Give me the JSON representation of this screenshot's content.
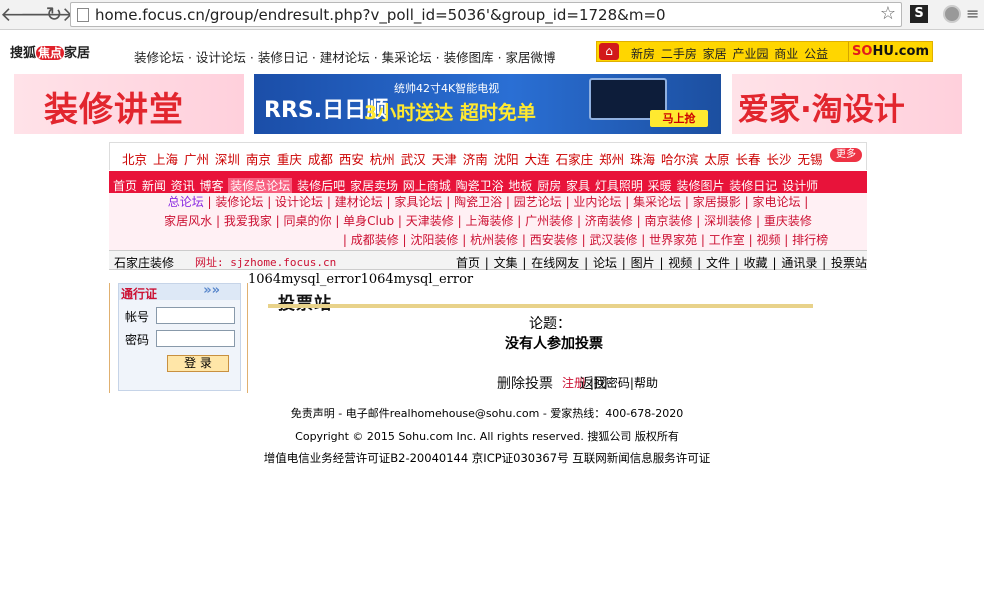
{
  "browser": {
    "url": "home.focus.cn/group/endresult.php?v_poll_id=5036'&group_id=1728&m=0",
    "ext_label": "S"
  },
  "header": {
    "logo_sohu": "搜狐",
    "logo_mid": "焦点",
    "logo_home": "家居",
    "topnav": "装修论坛 · 设计论坛 · 装修日记 · 建材论坛 · 集采论坛 · 装修图库 · 家居微博",
    "sohu_links": "新房 二手房 家居 产业园 商业 公益",
    "sohu_brand_pre": "S",
    "sohu_brand_o": "O",
    "sohu_brand_post": "HU.com"
  },
  "banners": {
    "left": "装修讲堂",
    "mid_rrs": "RRS.日日顺",
    "mid_line1": "统帅42寸4K智能电视",
    "mid_line2": "3小时送达 超时免单",
    "mid_go": "马上抢",
    "right": "爱家·淘设计"
  },
  "cities": {
    "list": "北京 上海 广州 深圳 南京 重庆 成都 西安 杭州 武汉 天津 济南 沈阳 大连 石家庄 郑州 珠海 哈尔滨 太原 长春 长沙 无锡",
    "more": "更多"
  },
  "mainnav": {
    "before": "首页 新闻 资讯 博客",
    "active": "装修总论坛",
    "after": "装修后吧 家居卖场 网上商城 陶瓷卫浴 地板 厨房 家具 灯具照明 采暖 装修图片 装修日记 设计师"
  },
  "subnav": {
    "row1_hl": "总论坛",
    "row1": "| 装修论坛 | 设计论坛 | 建材论坛 | 家具论坛 | 陶瓷卫浴 | 园艺论坛 | 业内论坛 | 集采论坛 | 家居摄影 | 家电论坛 |",
    "row2": "家居风水 | 我爱我家 | 同桌的你 | 单身Club | 天津装修 | 上海装修 | 广州装修 | 济南装修 | 南京装修 | 深圳装修 | 重庆装修",
    "row3": "| 成都装修 | 沈阳装修 | 杭州装修 | 西安装修 | 武汉装修 | 世界家苑 | 工作室 | 视频 | 排行榜"
  },
  "sitebar": {
    "name": "石家庄装修",
    "url": "网址: sjzhome.focus.cn",
    "links": "首页 | 文集 | 在线网友 | 论坛 | 图片 | 视频 | 文件 | 收藏 | 通讯录 | 投票站"
  },
  "login": {
    "title": "通行证",
    "arrows": "»»",
    "account_label": "帐号",
    "password_label": "密码",
    "submit": "登 录",
    "register": "注册",
    "forgot": "找密码",
    "help": "帮助"
  },
  "content": {
    "error": "1064mysql_error1064mysql_error",
    "poll_title": "投票站",
    "topic_label": "论题：",
    "no_votes": "没有人参加投票",
    "delete_vote": "删除投票",
    "back": "返回"
  },
  "footer": {
    "line1": "免责声明 - 电子邮件realhomehouse@sohu.com - 爱家热线：400-678-2020",
    "line2": "Copyright © 2015 Sohu.com Inc. All rights reserved. 搜狐公司 版权所有",
    "line3": "增值电信业务经营许可证B2-20040144 京ICP证030367号 互联网新闻信息服务许可证"
  }
}
